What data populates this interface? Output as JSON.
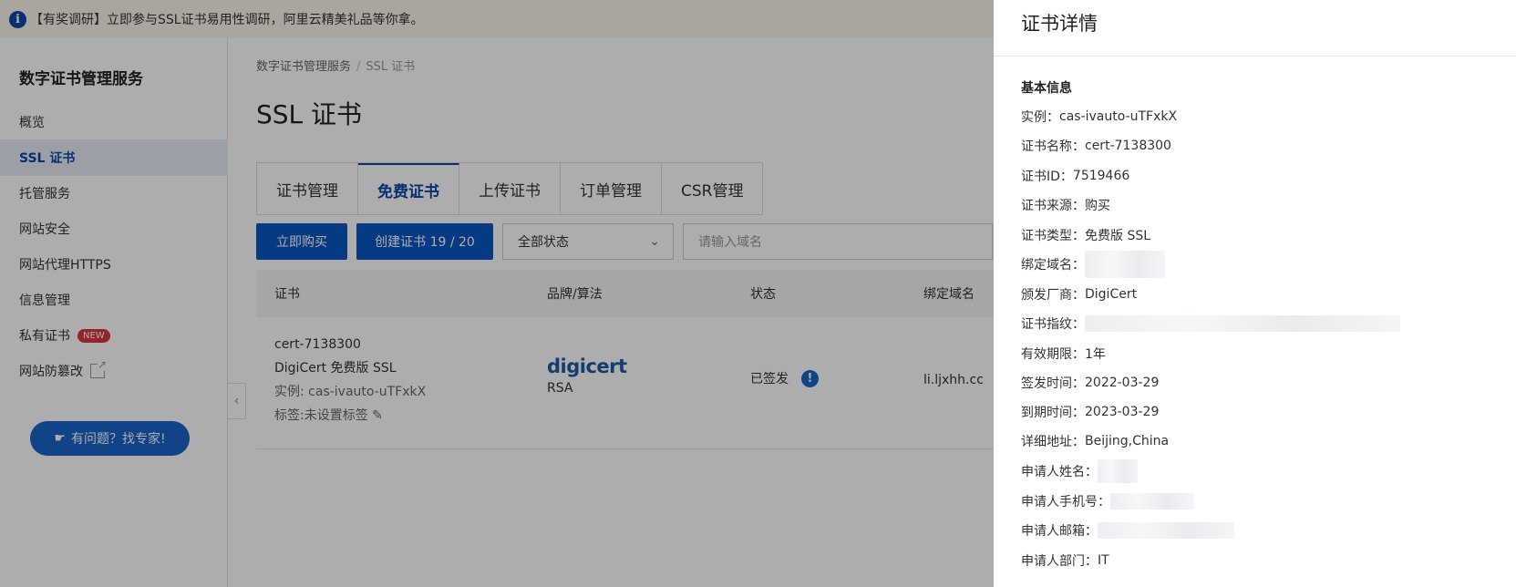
{
  "banner": {
    "icon": "info-icon",
    "text": "【有奖调研】立即参与SSL证书易用性调研，阿里云精美礼品等你拿。"
  },
  "sidebar": {
    "title": "数字证书管理服务",
    "items": [
      {
        "label": "概览"
      },
      {
        "label": "SSL 证书"
      },
      {
        "label": "托管服务"
      },
      {
        "label": "网站安全"
      },
      {
        "label": "网站代理HTTPS"
      },
      {
        "label": "信息管理"
      },
      {
        "label": "私有证书",
        "badge": "NEW"
      },
      {
        "label": "网站防篡改"
      }
    ],
    "expert_button": "有问题？找专家!"
  },
  "breadcrumb": {
    "root": "数字证书管理服务",
    "separator": "/",
    "current": "SSL 证书"
  },
  "page_title": "SSL 证书",
  "tabs": [
    "证书管理",
    "免费证书",
    "上传证书",
    "订单管理",
    "CSR管理"
  ],
  "toolbar": {
    "buy_label": "立即购买",
    "create_label": "创建证书 19 / 20",
    "status_select": "全部状态",
    "search_placeholder": "请输入域名"
  },
  "table": {
    "headers": [
      "证书",
      "品牌/算法",
      "状态",
      "绑定域名"
    ],
    "row": {
      "name": "cert-7138300",
      "product": "DigiCert 免费版 SSL",
      "instance": "实例: cas-ivauto-uTFxkX",
      "tag": "标签:未设置标签",
      "brand_logo": "digicert",
      "algorithm": "RSA",
      "status": "已签发",
      "domain": "li.ljxhh.cc"
    }
  },
  "drawer": {
    "title": "证书详情",
    "section": "基本信息",
    "fields": [
      {
        "label": "实例：",
        "value": "cas-ivauto-uTFxkX"
      },
      {
        "label": "证书名称：",
        "value": "cert-7138300"
      },
      {
        "label": "证书ID：",
        "value": "7519466"
      },
      {
        "label": "证书来源：",
        "value": "购买"
      },
      {
        "label": "证书类型：",
        "value": "免费版 SSL"
      },
      {
        "label": "绑定域名：",
        "value": ""
      },
      {
        "label": "颁发厂商：",
        "value": "DigiCert"
      },
      {
        "label": "证书指纹：",
        "value": ""
      },
      {
        "label": "有效期限：",
        "value": "1年"
      },
      {
        "label": "签发时间：",
        "value": "2022-03-29"
      },
      {
        "label": "到期时间：",
        "value": "2023-03-29"
      },
      {
        "label": "详细地址：",
        "value": "Beijing,China"
      },
      {
        "label": "申请人姓名：",
        "value": ""
      },
      {
        "label": "申请人手机号：",
        "value": ""
      },
      {
        "label": "申请人邮箱：",
        "value": ""
      },
      {
        "label": "申请人部门：",
        "value": "IT"
      }
    ]
  },
  "colors": {
    "accent": "#0a48a8",
    "primary_button": "#0a56c2",
    "badge": "#d9363e"
  }
}
